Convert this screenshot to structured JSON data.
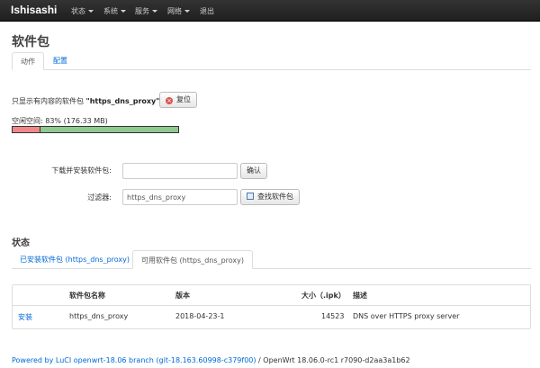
{
  "navbar": {
    "brand": "Ishisashi",
    "menus": [
      "状态",
      "系统",
      "服务",
      "网络"
    ],
    "logout": "退出"
  },
  "page": {
    "title": "软件包",
    "tabs": [
      "动作",
      "配置"
    ]
  },
  "filter_note": {
    "prefix": "只显示有内容的软件包",
    "query": "\"https_dns_proxy\"",
    "reset_label": "复位"
  },
  "free_space": {
    "label": "空闲空间:",
    "value": "83% (176.33 MB)",
    "percent_free": 83
  },
  "download_form": {
    "label": "下载并安装软件包:",
    "value": "",
    "confirm_label": "确认"
  },
  "filter_form": {
    "label": "过滤器:",
    "value": "https_dns_proxy",
    "find_label": "查找软件包"
  },
  "status": {
    "title": "状态",
    "tabs": [
      "已安装软件包 (https_dns_proxy)",
      "可用软件包 (https_dns_proxy)"
    ],
    "table": {
      "headers": [
        "软件包名称",
        "版本",
        "大小（.ipk）",
        "描述"
      ],
      "rows": [
        {
          "action": "安装",
          "name": "https_dns_proxy",
          "version": "2018-04-23-1",
          "size": "14523",
          "description": "DNS over HTTPS proxy server"
        }
      ]
    }
  },
  "footer": {
    "link": "Powered by LuCI openwrt-18.06 branch (git-18.163.60998-c379f00)",
    "text": " / OpenWrt 18.06.0-rc1 r7090-d2aa3a1b62"
  },
  "colors": {
    "link": "#0069d6",
    "used_bar": "#f0888a",
    "free_bar": "#8fc98f",
    "reset_icon": "#d9534f"
  }
}
